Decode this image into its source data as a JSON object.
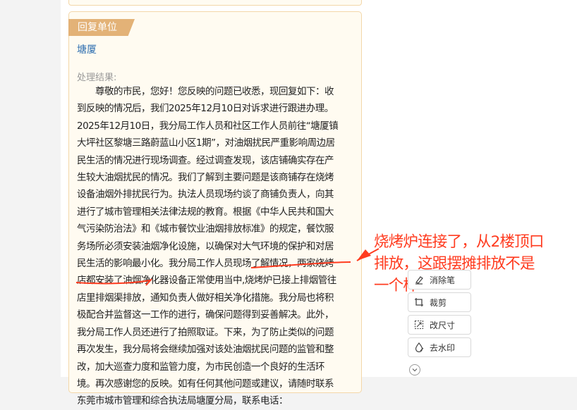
{
  "card": {
    "tab_label": "回复单位",
    "unit_name": "塘厦",
    "result_label": "处理结果:",
    "lines": [
      "　　尊敬的市民，您好！您反映的问题已收悉，现回复如下：收",
      "到反映的情况后，我们2025年12月10日对诉求进行跟进办理。",
      "2025年12月10日，我分局工作人员和社区工作人员前往“塘厦镇",
      "大坪社区黎塘三路蔚蓝山小区1期”，对油烟扰民严重影响周边居",
      "民生活的情况进行现场调查。经过调查发现，该店铺确实存在产",
      "生较大油烟扰民的情况。我们了解到主要问题是该商铺存在烧烤",
      "设备油烟外排扰民行为。执法人员现场约谈了商铺负责人，向其",
      "进行了城市管理相关法律法规的教育。根据《中华人民共和国大",
      "气污染防治法》和《城市餐饮业油烟排放标准》的规定，餐饮服",
      "务场所必须安装油烟净化设施，以确保对大气环境的保护和对居",
      "民生活的影响最小化。我分局工作人员现场了解情况，两家烧烤",
      "店都安装了油烟净化器设备正常使用当中,烧烤炉已接上排烟管往",
      "店里排烟渠排放，通知负责人做好相关净化措施。我分局也将积",
      "极配合并监督这一工作的进行，确保问题得到妥善解决。此外，",
      "我分局工作人员还进行了拍照取证。下来，为了防止类似的问题",
      "再次发生，我分局将会继续加强对该处油烟扰民问题的监管和整",
      "改，加大巡查力度和监管力度，为市民创造一个良好的生活环",
      "境。再次感谢您的反映。如有任何其他问题或建议，请随时联系",
      "东莞市城市管理和综合执法局塘厦分局，联系电话："
    ]
  },
  "annotation": {
    "lines": [
      "烧烤炉连接了，从2楼顶口",
      "排放，这跟摆摊排放不是",
      "一个样"
    ],
    "color": "#ff3b1f"
  },
  "toolbar": {
    "buttons": [
      {
        "label": "消除笔",
        "icon": "eraser-pen-icon"
      },
      {
        "label": "裁剪",
        "icon": "crop-icon"
      },
      {
        "label": "改尺寸",
        "icon": "resize-icon"
      },
      {
        "label": "去水印",
        "icon": "remove-watermark-icon"
      }
    ],
    "more_icon": "chevron-down-icon"
  },
  "colors": {
    "tab": "#e3b277",
    "card_bg": "#fffbf1",
    "card_border": "#f3d7a9",
    "link": "#2f6fb0"
  }
}
